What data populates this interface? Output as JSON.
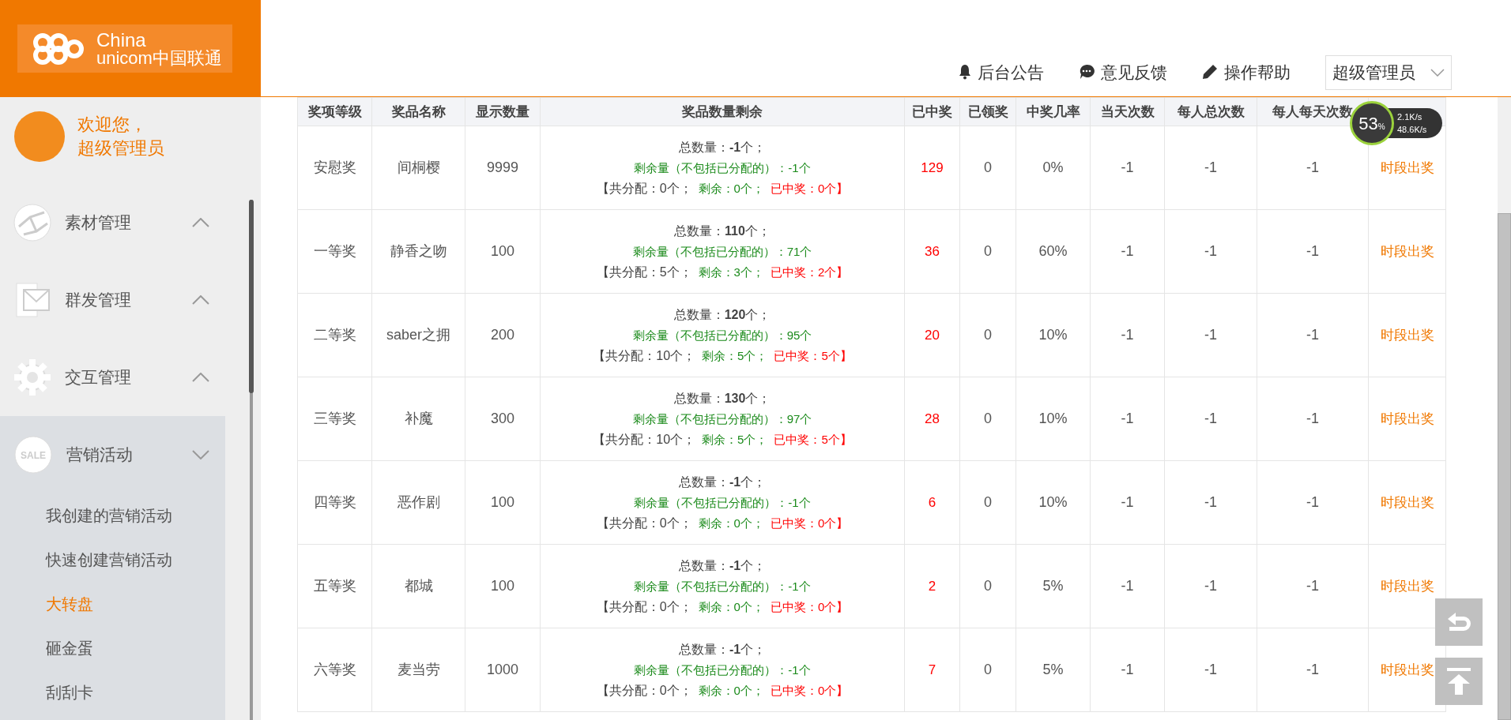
{
  "logo": {
    "line1": "China",
    "line2": "unicom中国联通"
  },
  "topnav": [
    {
      "kind": "bell",
      "label": "后台公告"
    },
    {
      "kind": "chat",
      "label": "意见反馈"
    },
    {
      "kind": "pen",
      "label": "操作帮助"
    }
  ],
  "user_menu": {
    "label": "超级管理员"
  },
  "sidebar": {
    "welcome": [
      "欢迎您，",
      "超级管理员"
    ],
    "items": [
      {
        "kind": "network",
        "label": "素材管理",
        "expanded": false
      },
      {
        "kind": "mail",
        "label": "群发管理",
        "expanded": false
      },
      {
        "kind": "gear",
        "label": "交互管理",
        "expanded": false
      },
      {
        "kind": "sale",
        "label": "营销活动",
        "icon_text": "SALE",
        "expanded": true,
        "children": [
          {
            "label": "我创建的营销活动",
            "selected": false
          },
          {
            "label": "快速创建营销活动",
            "selected": false
          },
          {
            "label": "大转盘",
            "selected": true
          },
          {
            "label": "砸金蛋",
            "selected": false
          },
          {
            "label": "刮刮卡",
            "selected": false
          }
        ]
      }
    ]
  },
  "table": {
    "columns": [
      "奖项等级",
      "奖品名称",
      "显示数量",
      "奖品数量剩余",
      "已中奖",
      "已领奖",
      "中奖几率",
      "当天次数",
      "每人总次数",
      "每人每天次数",
      ""
    ],
    "rows": [
      {
        "level": "安慰奖",
        "prize": "间桐樱",
        "shown": "9999",
        "total": "总数量：**-1**个；",
        "remaining": "剩余量（不包括已分配的）：-1个",
        "allocated": "【共分配：0个；",
        "alloc_left": "剩余：0个；",
        "alloc_won": "已中奖：0个】",
        "won": "129",
        "claimed": "0",
        "rate": "0%",
        "daily": "-1",
        "per_total": "-1",
        "per_daily": "-1",
        "action": "时段出奖"
      },
      {
        "level": "一等奖",
        "prize": "静香之吻",
        "shown": "100",
        "total": "总数量：**110**个；",
        "remaining": "剩余量（不包括已分配的）：71个",
        "allocated": "【共分配：5个；",
        "alloc_left": "剩余：3个；",
        "alloc_won": "已中奖：2个】",
        "won": "36",
        "claimed": "0",
        "rate": "60%",
        "daily": "-1",
        "per_total": "-1",
        "per_daily": "-1",
        "action": "时段出奖"
      },
      {
        "level": "二等奖",
        "prize": "saber之拥",
        "shown": "200",
        "total": "总数量：**120**个；",
        "remaining": "剩余量（不包括已分配的）：95个",
        "allocated": "【共分配：10个；",
        "alloc_left": "剩余：5个；",
        "alloc_won": "已中奖：5个】",
        "won": "20",
        "claimed": "0",
        "rate": "10%",
        "daily": "-1",
        "per_total": "-1",
        "per_daily": "-1",
        "action": "时段出奖"
      },
      {
        "level": "三等奖",
        "prize": "补魔",
        "shown": "300",
        "total": "总数量：**130**个；",
        "remaining": "剩余量（不包括已分配的）：97个",
        "allocated": "【共分配：10个；",
        "alloc_left": "剩余：5个；",
        "alloc_won": "已中奖：5个】",
        "won": "28",
        "claimed": "0",
        "rate": "10%",
        "daily": "-1",
        "per_total": "-1",
        "per_daily": "-1",
        "action": "时段出奖"
      },
      {
        "level": "四等奖",
        "prize": "恶作剧",
        "shown": "100",
        "total": "总数量：**-1**个；",
        "remaining": "剩余量（不包括已分配的）：-1个",
        "allocated": "【共分配：0个；",
        "alloc_left": "剩余：0个；",
        "alloc_won": "已中奖：0个】",
        "won": "6",
        "claimed": "0",
        "rate": "10%",
        "daily": "-1",
        "per_total": "-1",
        "per_daily": "-1",
        "action": "时段出奖"
      },
      {
        "level": "五等奖",
        "prize": "都城",
        "shown": "100",
        "total": "总数量：**-1**个；",
        "remaining": "剩余量（不包括已分配的）：-1个",
        "allocated": "【共分配：0个；",
        "alloc_left": "剩余：0个；",
        "alloc_won": "已中奖：0个】",
        "won": "2",
        "claimed": "0",
        "rate": "5%",
        "daily": "-1",
        "per_total": "-1",
        "per_daily": "-1",
        "action": "时段出奖"
      },
      {
        "level": "六等奖",
        "prize": "麦当劳",
        "shown": "1000",
        "total": "总数量：**-1**个；",
        "remaining": "剩余量（不包括已分配的）：-1个",
        "allocated": "【共分配：0个；",
        "alloc_left": "剩余：0个；",
        "alloc_won": "已中奖：0个】",
        "won": "7",
        "claimed": "0",
        "rate": "5%",
        "daily": "-1",
        "per_total": "-1",
        "per_daily": "-1",
        "action": "时段出奖"
      }
    ]
  },
  "speed_widget": {
    "percent": "53",
    "unit": "%",
    "up": "2.1K/s",
    "down": "48.6K/s"
  }
}
